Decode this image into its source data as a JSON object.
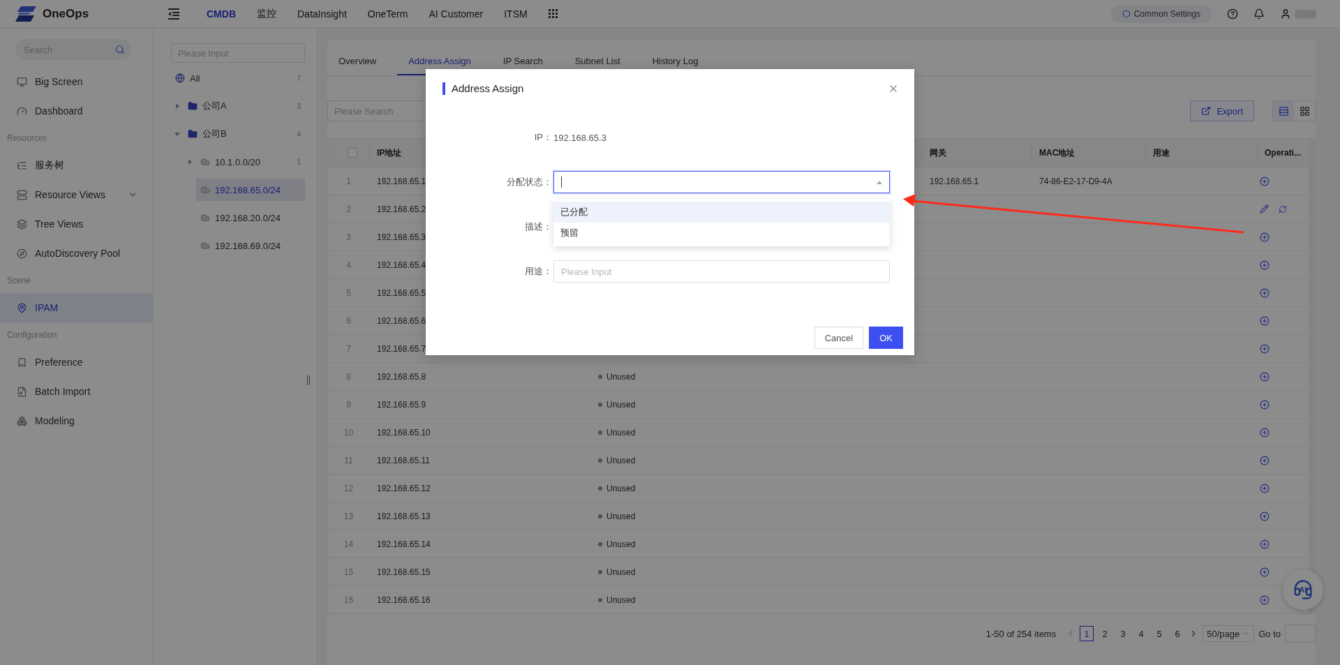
{
  "topbar": {
    "brand": "OneOps",
    "nav": [
      {
        "label": "CMDB",
        "selected": true
      },
      {
        "label": "监控",
        "selected": false
      },
      {
        "label": "DataInsight",
        "selected": false
      },
      {
        "label": "OneTerm",
        "selected": false
      },
      {
        "label": "AI Customer",
        "selected": false
      },
      {
        "label": "ITSM",
        "selected": false
      }
    ],
    "settings": "Common Settings"
  },
  "sidebar": {
    "search": {
      "placeholder": "Search"
    },
    "items": [
      {
        "kind": "item",
        "label": "Big Screen",
        "selected": false
      },
      {
        "kind": "item",
        "label": "Dashboard",
        "selected": false
      },
      {
        "kind": "heading",
        "label": "Resources"
      },
      {
        "kind": "item",
        "label": "服务树",
        "selected": false
      },
      {
        "kind": "item",
        "label": "Resource Views",
        "selected": false,
        "expanded": false
      },
      {
        "kind": "item",
        "label": "Tree Views",
        "selected": false
      },
      {
        "kind": "item",
        "label": "AutoDiscovery Pool",
        "selected": false
      },
      {
        "kind": "heading",
        "label": "Scene"
      },
      {
        "kind": "item",
        "label": "IPAM",
        "selected": true
      },
      {
        "kind": "heading",
        "label": "Configuration"
      },
      {
        "kind": "item",
        "label": "Preference",
        "selected": false
      },
      {
        "kind": "item",
        "label": "Batch Import",
        "selected": false
      },
      {
        "kind": "item",
        "label": "Modeling",
        "selected": false
      }
    ]
  },
  "tree": {
    "search": {
      "placeholder": "Please Input"
    },
    "items": [
      {
        "kind": "root",
        "label": "All",
        "count": "7",
        "selected": false
      },
      {
        "kind": "folder",
        "label": "公司A",
        "count": "3",
        "selected": false,
        "expanded": false
      },
      {
        "kind": "folder",
        "label": "公司B",
        "count": "4",
        "selected": false,
        "expanded": true,
        "children": [
          {
            "kind": "subnet",
            "label": "10.1.0.0/20",
            "count": "1",
            "selected": false,
            "expanded": false
          },
          {
            "kind": "subnet",
            "label": "192.168.65.0/24",
            "selected": true
          },
          {
            "kind": "subnet",
            "label": "192.168.20.0/24",
            "selected": false
          },
          {
            "kind": "subnet",
            "label": "192.168.69.0/24",
            "selected": false
          }
        ]
      }
    ]
  },
  "tabs": [
    {
      "label": "Overview",
      "selected": false
    },
    {
      "label": "Address Assign",
      "selected": true
    },
    {
      "label": "IP Search",
      "selected": false
    },
    {
      "label": "Subnet List",
      "selected": false
    },
    {
      "label": "History Log",
      "selected": false
    }
  ],
  "search": {
    "placeholder": "Please Search"
  },
  "export": "Export",
  "view_modes": [
    {
      "kind": "list",
      "selected": true
    },
    {
      "kind": "grid",
      "selected": false
    }
  ],
  "table": {
    "header_checkbox": {
      "checked": false
    },
    "columns": [
      {
        "label": "IP地址"
      },
      {
        "label": "网关"
      },
      {
        "label": "MAC地址"
      },
      {
        "label": "用途"
      },
      {
        "label": "Operati..."
      }
    ],
    "rows": [
      {
        "index": "1",
        "ip": "192.168.65.1",
        "gateway": "192.168.65.1",
        "mac": "74-86-E2-17-D9-4A",
        "kind": "add"
      },
      {
        "index": "2",
        "ip": "192.168.65.2",
        "kind": "edit"
      },
      {
        "index": "3",
        "ip": "192.168.65.3",
        "kind": "add"
      },
      {
        "index": "4",
        "ip": "192.168.65.4",
        "kind": "add"
      },
      {
        "index": "5",
        "ip": "192.168.65.5",
        "kind": "add"
      },
      {
        "index": "6",
        "ip": "192.168.65.6",
        "kind": "add"
      },
      {
        "index": "7",
        "ip": "192.168.65.7",
        "kind": "add"
      },
      {
        "index": "8",
        "ip": "192.168.65.8",
        "status": "Unused",
        "kind": "add"
      },
      {
        "index": "9",
        "ip": "192.168.65.9",
        "status": "Unused",
        "kind": "add"
      },
      {
        "index": "10",
        "ip": "192.168.65.10",
        "status": "Unused",
        "kind": "add"
      },
      {
        "index": "11",
        "ip": "192.168.65.11",
        "status": "Unused",
        "kind": "add"
      },
      {
        "index": "12",
        "ip": "192.168.65.12",
        "status": "Unused",
        "kind": "add"
      },
      {
        "index": "13",
        "ip": "192.168.65.13",
        "status": "Unused",
        "kind": "add"
      },
      {
        "index": "14",
        "ip": "192.168.65.14",
        "status": "Unused",
        "kind": "add"
      },
      {
        "index": "15",
        "ip": "192.168.65.15",
        "status": "Unused",
        "kind": "add"
      },
      {
        "index": "16",
        "ip": "192.168.65.16",
        "status": "Unused",
        "kind": "add"
      }
    ]
  },
  "pagination": {
    "summary": "1-50 of 254 items",
    "pages": [
      {
        "label": "1",
        "selected": true
      },
      {
        "label": "2",
        "selected": false
      },
      {
        "label": "3",
        "selected": false
      },
      {
        "label": "4",
        "selected": false
      },
      {
        "label": "5",
        "selected": false
      },
      {
        "label": "6",
        "selected": false
      }
    ],
    "page_size": "50/page",
    "goto": "Go to"
  },
  "assistant": {
    "label": "AI"
  },
  "modal": {
    "title": "Address Assign",
    "ip": {
      "label": "IP：",
      "value": "192.168.65.3"
    },
    "status": {
      "label": "分配状态：",
      "focused": true,
      "open": true,
      "options": [
        {
          "label": "已分配",
          "active": true
        },
        {
          "label": "预留",
          "active": false
        }
      ]
    },
    "description": {
      "label": "描述："
    },
    "purpose": {
      "label": "用途：",
      "placeholder": "Please Input"
    },
    "buttons": {
      "cancel": "Cancel",
      "ok": "OK"
    }
  }
}
